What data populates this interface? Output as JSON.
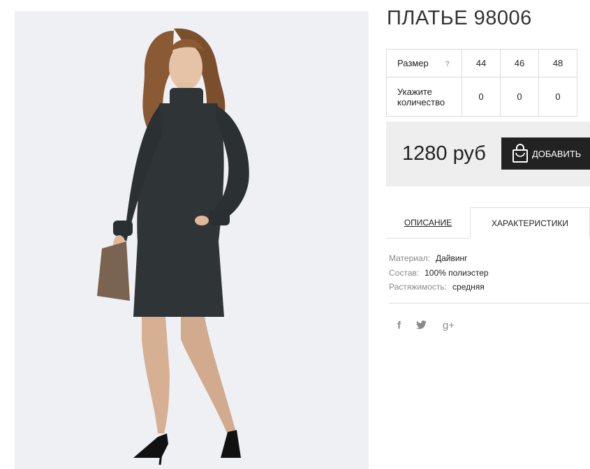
{
  "product": {
    "title": "ПЛАТЬЕ 98006"
  },
  "sizes": {
    "size_label": "Размер",
    "help": "?",
    "values": [
      "44",
      "46",
      "48"
    ],
    "qty_label_line1": "Укажите",
    "qty_label_line2": "количество",
    "quantities": [
      "0",
      "0",
      "0"
    ]
  },
  "purchase": {
    "price": "1280 руб",
    "cart_button": "ДОБАВИТЬ",
    "cart_icon": "shopping-bag-icon"
  },
  "tabs": {
    "description": "ОПИСАНИЕ",
    "characteristics": "ХАРАКТЕРИСТИКИ",
    "active": "characteristics"
  },
  "specs": [
    {
      "key": "Материал:",
      "value": "Дайвинг"
    },
    {
      "key": "Состав:",
      "value": "100% полиэстер"
    },
    {
      "key": "Растяжимость:",
      "value": "средняя"
    }
  ],
  "social": {
    "facebook": "f",
    "twitter": "twitter-icon",
    "googleplus": "g+"
  },
  "colors": {
    "photo_bg": "#eef0f4",
    "dress": "#2f3537",
    "button_bg": "#222222",
    "price_box_bg": "#eeeeee"
  }
}
